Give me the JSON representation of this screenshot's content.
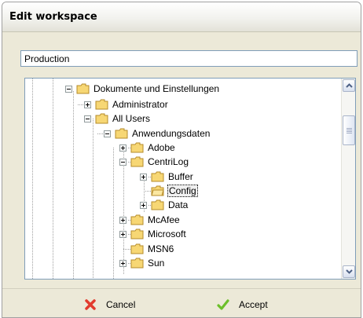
{
  "dialog": {
    "title": "Edit workspace",
    "name_value": "Production",
    "cancel_label": "Cancel",
    "accept_label": "Accept"
  },
  "tree": {
    "nodes": [
      {
        "label": "Dokumente und Einstellungen",
        "expander": "minus",
        "icon": "folder-icon"
      },
      {
        "label": "Administrator",
        "expander": "plus",
        "icon": "folder-icon"
      },
      {
        "label": "All Users",
        "expander": "minus",
        "icon": "folder-icon"
      },
      {
        "label": "Anwendungsdaten",
        "expander": "minus",
        "icon": "folder-icon"
      },
      {
        "label": "Adobe",
        "expander": "plus",
        "icon": "folder-icon"
      },
      {
        "label": "CentriLog",
        "expander": "minus",
        "icon": "folder-icon"
      },
      {
        "label": "Buffer",
        "expander": "plus",
        "icon": "folder-icon"
      },
      {
        "label": "Config",
        "expander": "none",
        "icon": "folder-icon",
        "selected": true
      },
      {
        "label": "Data",
        "expander": "plus",
        "icon": "folder-icon"
      },
      {
        "label": "McAfee",
        "expander": "plus",
        "icon": "folder-icon"
      },
      {
        "label": "Microsoft",
        "expander": "plus",
        "icon": "folder-icon"
      },
      {
        "label": "MSN6",
        "expander": "none",
        "icon": "folder-icon"
      },
      {
        "label": "Sun",
        "expander": "plus",
        "icon": "folder-icon"
      }
    ]
  },
  "icons": {
    "cancel": "red-x-icon",
    "accept": "green-check-icon",
    "scroll_up": "arrow-up-icon",
    "scroll_down": "arrow-down-icon"
  },
  "colors": {
    "dialog_bg": "#ece9d8",
    "input_border": "#7f9db9",
    "folder": "#f7d774",
    "cancel_icon": "#e23b2e",
    "accept_icon": "#6cbf2a"
  }
}
